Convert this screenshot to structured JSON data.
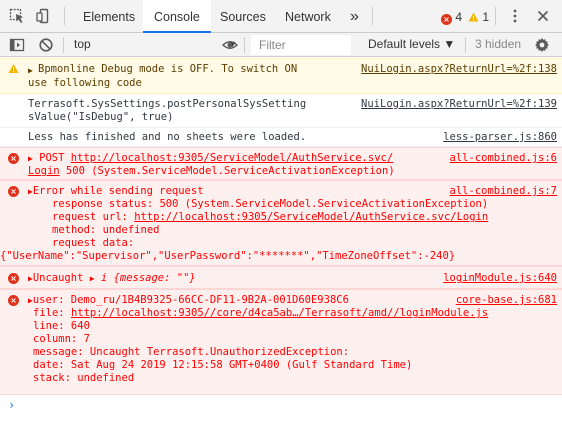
{
  "tabs": {
    "elements": "Elements",
    "console": "Console",
    "sources": "Sources",
    "network": "Network",
    "more": "»"
  },
  "badges": {
    "errors": "4",
    "warnings": "1"
  },
  "toolbar": {
    "context": "top",
    "filter_placeholder": "Filter",
    "levels": "Default levels ▼",
    "hidden": "3 hidden"
  },
  "messages": {
    "m1": {
      "line1": "Bpmonline Debug mode is OFF. To switch ON",
      "line2": "use following code",
      "source": "NuiLogin.aspx?ReturnUrl=%2f:138"
    },
    "m2": {
      "line1": "Terrasoft.SysSettings.postPersonalSysSetting",
      "line2": "sValue(\"IsDebug\", true)",
      "source": "NuiLogin.aspx?ReturnUrl=%2f:139"
    },
    "m3": {
      "line1": "Less has finished and no sheets were loaded.",
      "source": "less-parser.js:860"
    },
    "m4": {
      "method": "POST ",
      "url": "http://localhost:9305/ServiceModel/AuthService.svc/",
      "url2": "Login",
      "rest": " 500 (System.ServiceModel.ServiceActivationException)",
      "source": "all-combined.js:6"
    },
    "m5": {
      "line1": "Error while sending request",
      "line2": "response status: 500 (System.ServiceModel.ServiceActivationException)",
      "line3_label": "request url: ",
      "line3_url": "http://localhost:9305/ServiceModel/AuthService.svc/Login",
      "line4": "method: undefined",
      "line5": "request data:",
      "line6": "{\"UserName\":\"Supervisor\",\"UserPassword\":\"*******\",\"TimeZoneOffset\":-240}",
      "source": "all-combined.js:7"
    },
    "m6": {
      "label": "Uncaught ",
      "obj": "{message: \"\"}",
      "source": "loginModule.js:640"
    },
    "m7": {
      "line1": "user: Demo_ru/1B4B9325-66CC-DF11-9B2A-001D60E938C6",
      "line2_label": "file: ",
      "line2_url": "http://localhost:9305//core/d4ca5ab…/Terrasoft/amd//loginModule.js",
      "line3": "line: 640",
      "line4": "column: 7",
      "line5": "message: Uncaught Terrasoft.UnauthorizedException:",
      "line6": "date: Sat Aug 24 2019 12:15:58 GMT+0400 (Gulf Standard Time)",
      "line7": "stack: undefined",
      "source": "core-base.js:681"
    }
  },
  "prompt": "›"
}
